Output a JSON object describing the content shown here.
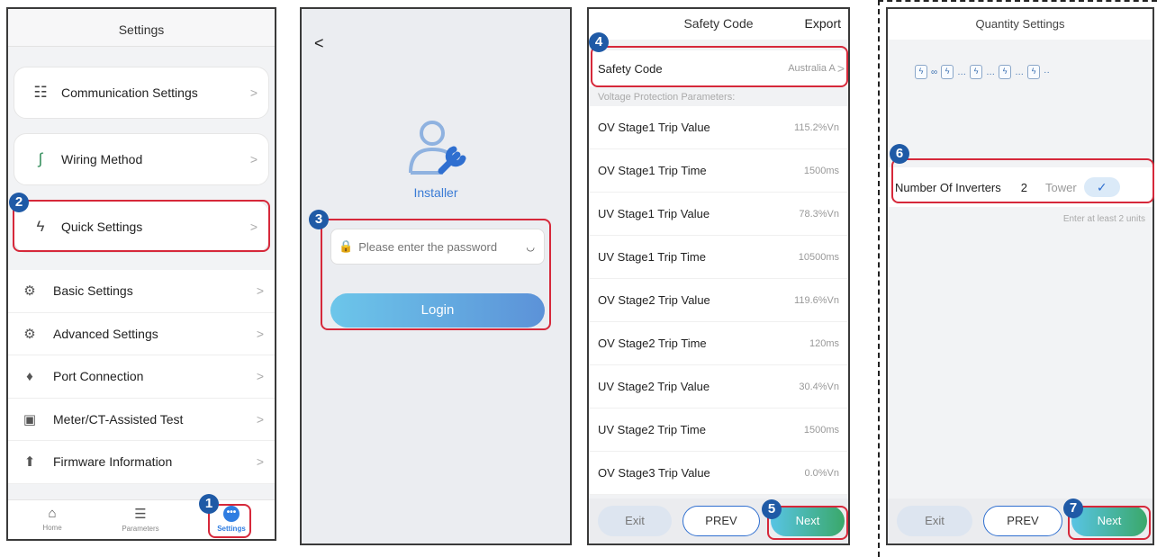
{
  "settings": {
    "title": "Settings",
    "cards": [
      {
        "label": "Communication Settings",
        "icon": "network-icon"
      },
      {
        "label": "Wiring Method",
        "icon": "wiring-icon"
      },
      {
        "label": "Quick Settings",
        "icon": "lightning-icon"
      }
    ],
    "list": [
      {
        "label": "Basic Settings",
        "icon": "gear-icon"
      },
      {
        "label": "Advanced Settings",
        "icon": "advanced-gear-icon"
      },
      {
        "label": "Port Connection",
        "icon": "port-icon"
      },
      {
        "label": "Meter/CT-Assisted Test",
        "icon": "meter-test-icon"
      },
      {
        "label": "Firmware Information",
        "icon": "firmware-icon"
      }
    ],
    "tabs": {
      "home": "Home",
      "parameters": "Parameters",
      "settings": "Settings"
    }
  },
  "login": {
    "back": "<",
    "role": "Installer",
    "password_placeholder": "Please enter the password",
    "login_label": "Login"
  },
  "safety": {
    "title": "Safety Code",
    "export": "Export",
    "code_label": "Safety Code",
    "code_value": "Australia A",
    "section": "Voltage Protection Parameters:",
    "params": [
      {
        "label": "OV Stage1 Trip Value",
        "value": "115.2%Vn"
      },
      {
        "label": "OV Stage1 Trip Time",
        "value": "1500ms"
      },
      {
        "label": "UV Stage1 Trip Value",
        "value": "78.3%Vn"
      },
      {
        "label": "UV Stage1 Trip Time",
        "value": "10500ms"
      },
      {
        "label": "OV Stage2 Trip Value",
        "value": "119.6%Vn"
      },
      {
        "label": "OV Stage2 Trip Time",
        "value": "120ms"
      },
      {
        "label": "UV Stage2 Trip Value",
        "value": "30.4%Vn"
      },
      {
        "label": "UV Stage2 Trip Time",
        "value": "1500ms"
      },
      {
        "label": "OV Stage3 Trip Value",
        "value": "0.0%Vn"
      }
    ],
    "buttons": {
      "exit": "Exit",
      "prev": "PREV",
      "next": "Next"
    }
  },
  "quantity": {
    "title": "Quantity Settings",
    "inverters_label": "Number Of Inverters",
    "inverters_value": "2",
    "tower": "Tower",
    "hint": "Enter at least 2 units",
    "buttons": {
      "exit": "Exit",
      "prev": "PREV",
      "next": "Next"
    }
  },
  "callouts": [
    "1",
    "2",
    "3",
    "4",
    "5",
    "6",
    "7"
  ],
  "colors": {
    "highlight": "#d6283a",
    "callout": "#1f5aa6",
    "accent": "#2f7de1"
  }
}
